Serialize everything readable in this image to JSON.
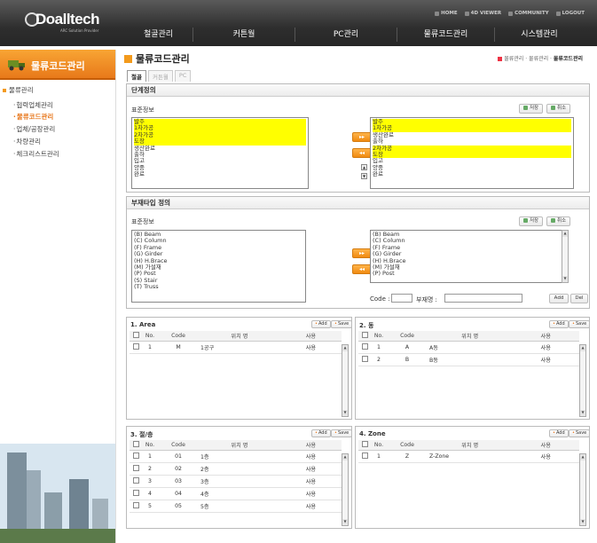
{
  "header": {
    "logo": {
      "name": "Doalltech",
      "tagline": "ARC Solution Provider"
    },
    "util": [
      "HOME",
      "4D VIEWER",
      "COMMUNITY",
      "LOGOUT"
    ],
    "gnb": [
      "철골관리",
      "커튼월",
      "PC관리",
      "물류코드관리",
      "시스템관리"
    ]
  },
  "lnb": {
    "title": "물류코드관리",
    "root": "물류관리",
    "items": [
      "협력업체관리",
      "물류코드관리",
      "업체/공장관리",
      "차량관리",
      "체크리스트관리"
    ],
    "active_index": 1
  },
  "content": {
    "title": "물류코드관리",
    "breadcrumb": {
      "a": "물류관리",
      "b": "물류관리",
      "c": "물류코드관리"
    },
    "tabs": [
      "철골",
      "커튼월",
      "PC"
    ],
    "stage": {
      "header": "단계정의",
      "label": "표준정보",
      "save": "저장",
      "cancel": "취소",
      "left": [
        "발주",
        "1차가공",
        "2차가공",
        "도장",
        "생산완료",
        "출하",
        "입고",
        "양중",
        "완료"
      ],
      "left_selected": [
        0,
        1,
        2,
        3
      ],
      "right": [
        "발주",
        "1차가공",
        "생산완료",
        "출하",
        "2차가공",
        "도장",
        "입고",
        "양중",
        "완료"
      ],
      "right_selected": [
        0,
        1,
        4,
        5
      ],
      "move_right": "▸▸",
      "move_left": "◂◂"
    },
    "member": {
      "header": "부재타입 정의",
      "label": "표준정보",
      "save": "저장",
      "cancel": "취소",
      "left": [
        "(B) Beam",
        "(C) Column",
        "(F) Frame",
        "(G) Girder",
        "(H) H.Brace",
        "(M) 가설재",
        "(P) Post",
        "(S) Stair",
        "(T) Truss"
      ],
      "right": [
        "(B) Beam",
        "(C) Column",
        "(F) Frame",
        "(G) Girder",
        "(H) H.Brace",
        "(M) 가설재",
        "(P) Post"
      ],
      "code_label": "Code :",
      "name_label": "부재명 :",
      "add": "Add",
      "del": "Del"
    },
    "grids": [
      {
        "title": "1. Area",
        "cols": [
          "No.",
          "Code",
          "위치 명",
          "사용"
        ],
        "rows": [
          [
            "1",
            "M",
            "1공구",
            "사용"
          ]
        ]
      },
      {
        "title": "2. 동",
        "cols": [
          "No.",
          "Code",
          "위치 명",
          "사용"
        ],
        "rows": [
          [
            "1",
            "A",
            "A동",
            "사용"
          ],
          [
            "2",
            "B",
            "B동",
            "사용"
          ]
        ]
      },
      {
        "title": "3. 절/층",
        "cols": [
          "No.",
          "Code",
          "위치 명",
          "사용"
        ],
        "rows": [
          [
            "1",
            "01",
            "1층",
            "사용"
          ],
          [
            "2",
            "02",
            "2층",
            "사용"
          ],
          [
            "3",
            "03",
            "3층",
            "사용"
          ],
          [
            "4",
            "04",
            "4층",
            "사용"
          ],
          [
            "5",
            "05",
            "5층",
            "사용"
          ]
        ]
      },
      {
        "title": "4. Zone",
        "cols": [
          "No.",
          "Code",
          "위치 명",
          "사용"
        ],
        "rows": [
          [
            "1",
            "Z",
            "Z-Zone",
            "사용"
          ]
        ]
      }
    ],
    "grid_add": "Add",
    "grid_save": "Save"
  }
}
